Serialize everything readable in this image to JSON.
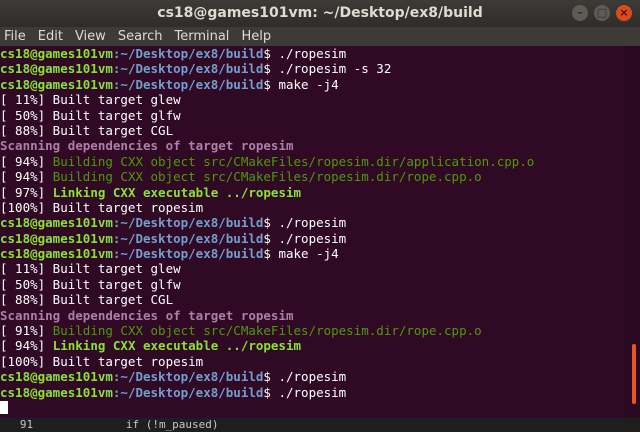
{
  "window": {
    "title": "cs18@games101vm: ~/Desktop/ex8/build",
    "controls": [
      "minimize",
      "maximize",
      "close"
    ]
  },
  "menubar": {
    "items": [
      "File",
      "Edit",
      "View",
      "Search",
      "Terminal",
      "Help"
    ]
  },
  "prompt": {
    "user_host": "cs18@games101vm",
    "path": ":~/Desktop/ex8/build",
    "dollar": "$ "
  },
  "lines": [
    {
      "kind": "prompt",
      "cmd": "./ropesim"
    },
    {
      "kind": "prompt",
      "cmd": "./ropesim -s 32"
    },
    {
      "kind": "prompt",
      "cmd": "make -j4"
    },
    {
      "kind": "text",
      "style": "t-white",
      "text": "[ 11%] Built target glew"
    },
    {
      "kind": "text",
      "style": "t-white",
      "text": "[ 50%] Built target glfw"
    },
    {
      "kind": "text",
      "style": "t-white",
      "text": "[ 88%] Built target CGL"
    },
    {
      "kind": "text",
      "style": "t-bold-magenta",
      "text": "Scanning dependencies of target ropesim"
    },
    {
      "kind": "split",
      "prefix": "[ 94%] ",
      "style": "t-green",
      "text": "Building CXX object src/CMakeFiles/ropesim.dir/application.cpp.o"
    },
    {
      "kind": "split",
      "prefix": "[ 94%] ",
      "style": "t-green",
      "text": "Building CXX object src/CMakeFiles/ropesim.dir/rope.cpp.o"
    },
    {
      "kind": "split",
      "prefix": "[ 97%] ",
      "style": "t-bold-green",
      "text": "Linking CXX executable ../ropesim"
    },
    {
      "kind": "text",
      "style": "t-white",
      "text": "[100%] Built target ropesim"
    },
    {
      "kind": "prompt",
      "cmd": "./ropesim"
    },
    {
      "kind": "prompt",
      "cmd": "./ropesim"
    },
    {
      "kind": "prompt",
      "cmd": "make -j4"
    },
    {
      "kind": "text",
      "style": "t-white",
      "text": "[ 11%] Built target glew"
    },
    {
      "kind": "text",
      "style": "t-white",
      "text": "[ 50%] Built target glfw"
    },
    {
      "kind": "text",
      "style": "t-white",
      "text": "[ 88%] Built target CGL"
    },
    {
      "kind": "text",
      "style": "t-bold-magenta",
      "text": "Scanning dependencies of target ropesim"
    },
    {
      "kind": "split",
      "prefix": "[ 91%] ",
      "style": "t-green",
      "text": "Building CXX object src/CMakeFiles/ropesim.dir/rope.cpp.o"
    },
    {
      "kind": "split",
      "prefix": "[ 94%] ",
      "style": "t-bold-green",
      "text": "Linking CXX executable ../ropesim"
    },
    {
      "kind": "text",
      "style": "t-white",
      "text": "[100%] Built target ropesim"
    },
    {
      "kind": "prompt",
      "cmd": "./ropesim"
    },
    {
      "kind": "prompt",
      "cmd": "./ropesim"
    },
    {
      "kind": "cursor"
    }
  ],
  "background_editor": {
    "text": "   91              if (!m_paused)"
  },
  "colors": {
    "terminal_bg": "#300a24",
    "prompt_user": "#8ae234",
    "prompt_path": "#729fcf",
    "scan_magenta": "#ad7fa8",
    "build_green": "#4e9a06",
    "link_green": "#8ae234",
    "close_button": "#df4a16"
  }
}
